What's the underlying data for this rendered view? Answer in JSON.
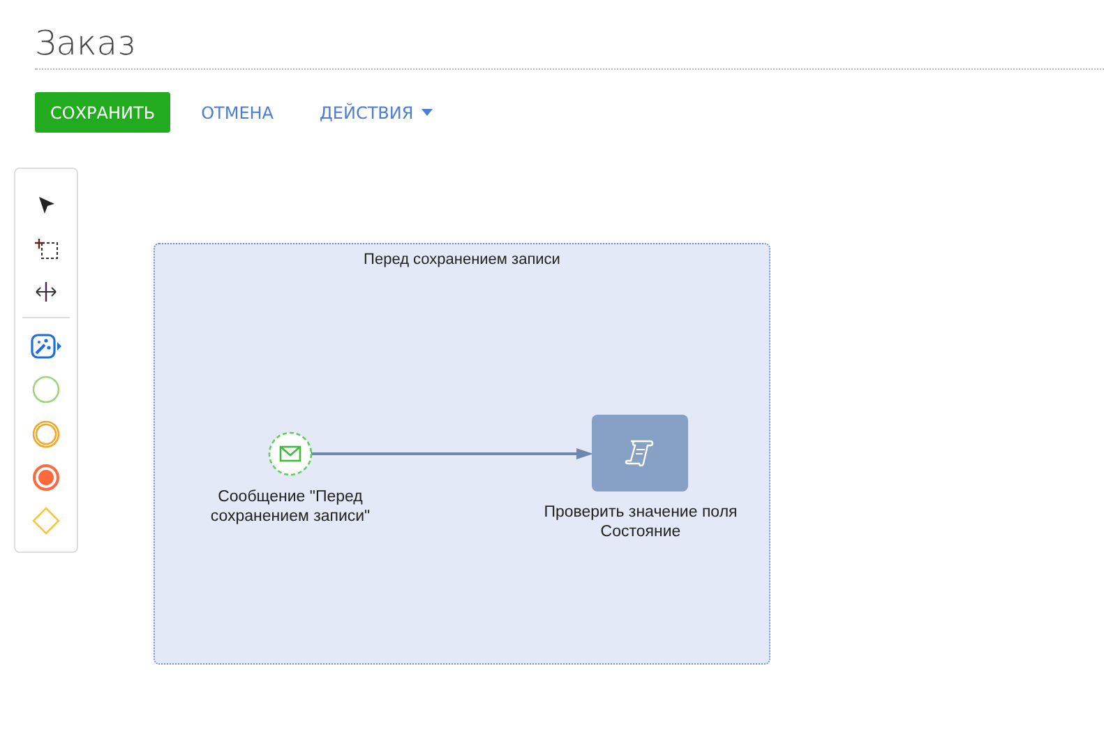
{
  "page": {
    "title": "Заказ"
  },
  "actions": [
    {
      "kind": "primary",
      "label": "СОХРАНИТЬ"
    },
    {
      "kind": "link",
      "label": "ОТМЕНА"
    },
    {
      "kind": "menu",
      "label": "ДЕЙСТВИЯ"
    }
  ],
  "toolbar": {
    "tools": [
      {
        "kind": "pointer"
      },
      {
        "kind": "lasso"
      },
      {
        "kind": "space"
      },
      {
        "kind": "divider"
      },
      {
        "kind": "magic"
      },
      {
        "kind": "start"
      },
      {
        "kind": "intermediate"
      },
      {
        "kind": "end"
      },
      {
        "kind": "gateway"
      }
    ]
  },
  "diagram": {
    "subprocess": {
      "title": "Перед сохранением записи"
    },
    "nodes": [
      {
        "kind": "message-start",
        "label": "Сообщение \"Перед сохранением записи\""
      },
      {
        "kind": "script-task",
        "label": "Проверить значение поля Состояние"
      }
    ]
  }
}
